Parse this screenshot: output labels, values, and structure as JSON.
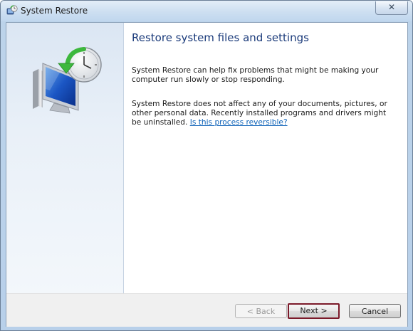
{
  "window": {
    "title": "System Restore",
    "close_glyph": "✕"
  },
  "main": {
    "heading": "Restore system files and settings",
    "paragraph1": "System Restore can help fix problems that might be making your computer run slowly or stop responding.",
    "paragraph2": "System Restore does not affect any of your documents, pictures, or other personal data. Recently installed programs and drivers might be uninstalled.",
    "link": "Is this process reversible?"
  },
  "footer": {
    "back_label": "< Back",
    "next_label": "Next >",
    "cancel_label": "Cancel"
  },
  "icons": {
    "title": "system-restore-icon",
    "illustration": "system-restore-monitor-clock-icon"
  },
  "colors": {
    "heading": "#1a3a7a",
    "link": "#0d62b8",
    "focus_border": "#7b1a2a"
  }
}
